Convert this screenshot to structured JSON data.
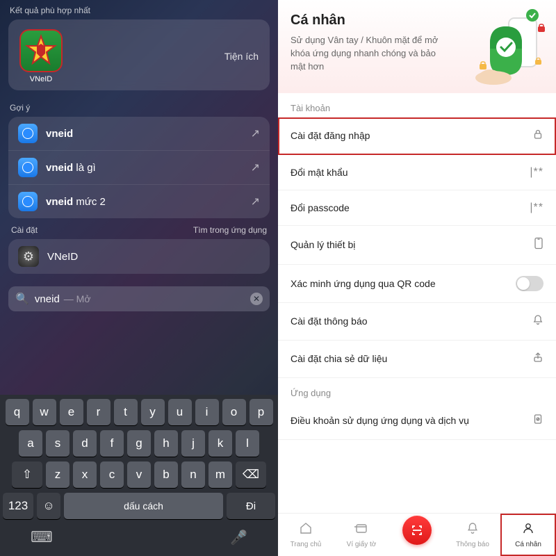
{
  "left": {
    "best_match_label": "Kết quả phù hợp nhất",
    "app_name": "VNeID",
    "utility_label": "Tiện ích",
    "suggestion_label": "Gợi ý",
    "suggestions": [
      {
        "prefix": "vneid",
        "rest": ""
      },
      {
        "prefix": "vneid",
        "rest": " là gì"
      },
      {
        "prefix": "vneid",
        "rest": " mức 2"
      }
    ],
    "settings_label": "Cài đặt",
    "search_in_app_label": "Tìm trong ứng dụng",
    "settings_item": "VNeID",
    "search_value": "vneid",
    "search_hint": "Mở",
    "keyboard": {
      "rows": [
        [
          "q",
          "w",
          "e",
          "r",
          "t",
          "y",
          "u",
          "i",
          "o",
          "p"
        ],
        [
          "a",
          "s",
          "d",
          "f",
          "g",
          "h",
          "j",
          "k",
          "l"
        ],
        [
          "z",
          "x",
          "c",
          "v",
          "b",
          "n",
          "m"
        ]
      ],
      "num_key": "123",
      "space_key": "dấu cách",
      "go_key": "Đi"
    }
  },
  "right": {
    "title": "Cá nhân",
    "subtitle": "Sử dụng Vân tay / Khuôn mặt để mở khóa ứng dụng nhanh chóng và bảo mật hơn",
    "section_account": "Tài khoản",
    "items_account": [
      {
        "label": "Cài đặt đăng nhập",
        "icon": "lock",
        "hl": true
      },
      {
        "label": "Đổi mật khẩu",
        "icon": "pass"
      },
      {
        "label": "Đổi passcode",
        "icon": "pass"
      },
      {
        "label": "Quản lý thiết bị",
        "icon": "device"
      },
      {
        "label": "Xác minh ứng dụng qua QR code",
        "icon": "toggle"
      },
      {
        "label": "Cài đặt thông báo",
        "icon": "bell"
      },
      {
        "label": "Cài đặt chia sẻ dữ liệu",
        "icon": "share"
      }
    ],
    "section_app": "Ứng dụng",
    "items_app": [
      {
        "label": "Điều khoản sử dụng ứng dụng và dịch vụ",
        "icon": "doc"
      }
    ],
    "tabs": [
      {
        "label": "Trang chủ",
        "icon": "home"
      },
      {
        "label": "Ví giấy tờ",
        "icon": "wallet"
      },
      {
        "label": "",
        "icon": "scan"
      },
      {
        "label": "Thông báo",
        "icon": "bell"
      },
      {
        "label": "Cá nhân",
        "icon": "person",
        "active": true,
        "hl": true
      }
    ]
  }
}
